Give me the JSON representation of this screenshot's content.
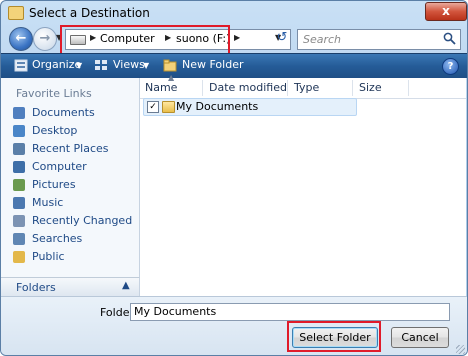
{
  "window": {
    "title": "Select a Destination",
    "close_label": "x"
  },
  "navbar": {
    "address_crumbs": [
      "Computer",
      "suono (F:)"
    ],
    "search_placeholder": "Search"
  },
  "toolbar": {
    "organize_label": "Organize",
    "views_label": "Views",
    "new_folder_label": "New Folder",
    "help_label": "?"
  },
  "sidebar": {
    "header": "Favorite Links",
    "items": [
      {
        "label": "Documents",
        "icon": "documents-icon",
        "color": "#4f7fbf"
      },
      {
        "label": "Desktop",
        "icon": "desktop-icon",
        "color": "#4a86c8"
      },
      {
        "label": "Recent Places",
        "icon": "recent-places-icon",
        "color": "#5a7fa8"
      },
      {
        "label": "Computer",
        "icon": "computer-icon",
        "color": "#3e6fa8"
      },
      {
        "label": "Pictures",
        "icon": "pictures-icon",
        "color": "#6a9a4f"
      },
      {
        "label": "Music",
        "icon": "music-icon",
        "color": "#4b78b0"
      },
      {
        "label": "Recently Changed",
        "icon": "recently-changed-icon",
        "color": "#7c93b3"
      },
      {
        "label": "Searches",
        "icon": "searches-icon",
        "color": "#5f86b3"
      },
      {
        "label": "Public",
        "icon": "public-folder-icon",
        "color": "#e3b84a"
      }
    ],
    "folders_label": "Folders"
  },
  "file_list": {
    "columns": [
      "Name",
      "Date modified",
      "Type",
      "Size"
    ],
    "items": [
      {
        "name": "My Documents",
        "checked": true
      }
    ]
  },
  "footer": {
    "folder_label": "Folder:",
    "folder_value": "My Documents",
    "select_button": "Select Folder",
    "cancel_button": "Cancel"
  },
  "colors": {
    "highlight_box": "#e01b2a",
    "toolbar_bg": "#255c98"
  }
}
